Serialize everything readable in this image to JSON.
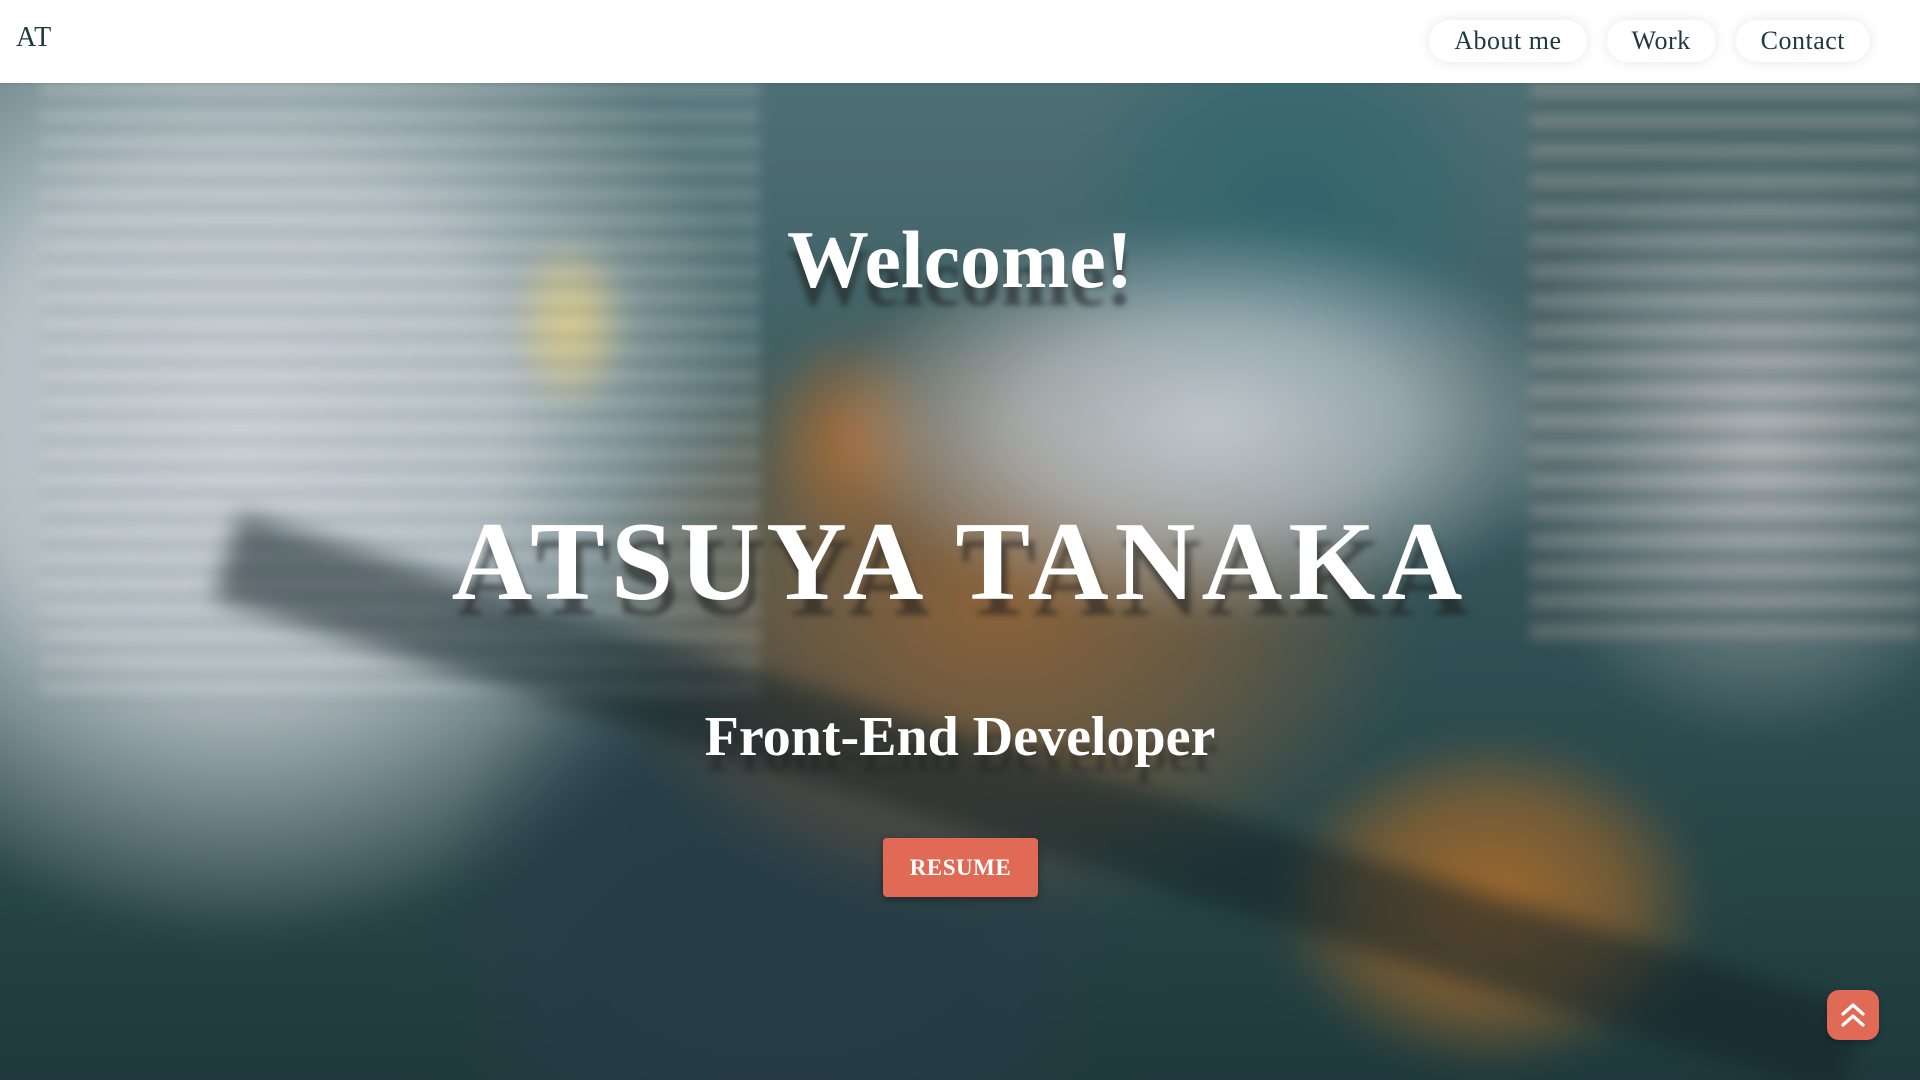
{
  "navbar": {
    "brand": "AT",
    "links": [
      {
        "label": "About me"
      },
      {
        "label": "Work"
      },
      {
        "label": "Contact"
      }
    ]
  },
  "hero": {
    "welcome": "Welcome!",
    "name": "ATSUYA TANAKA",
    "role": "Front-End Developer",
    "resume_label": "RESUME"
  },
  "scroll_top": {
    "icon": "double-chevron-up-icon"
  },
  "colors": {
    "accent": "#e06a55",
    "nav_text": "#1f3a3d",
    "nav_bg": "#ffffff",
    "hero_text": "#ffffff"
  }
}
